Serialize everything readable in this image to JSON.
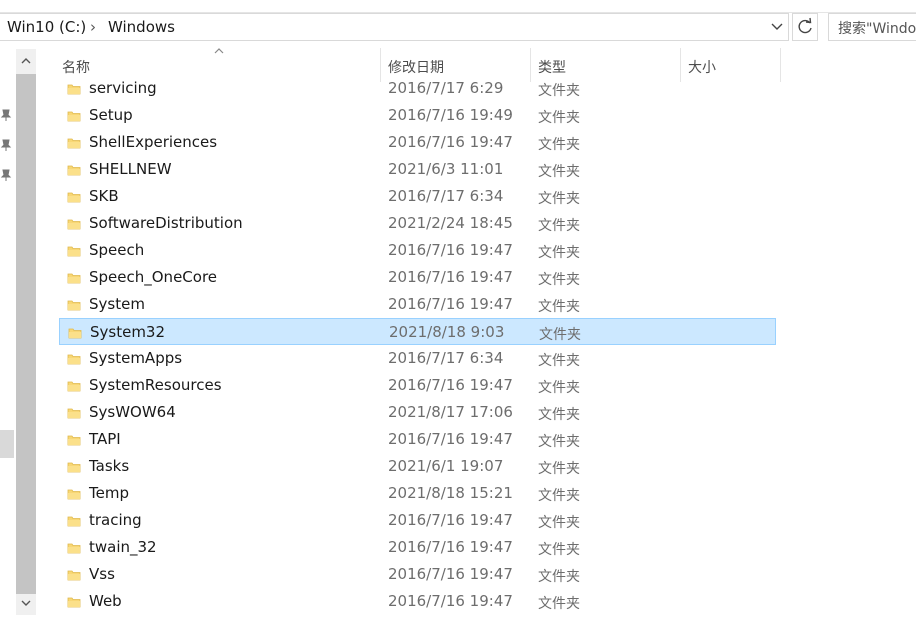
{
  "address": {
    "drive": "Win10 (C:)",
    "separator": "›",
    "folder": "Windows",
    "dropdown_icon": "chevron-down-icon"
  },
  "refresh_icon": "refresh-icon",
  "search": {
    "placeholder": "搜索\"Windows\""
  },
  "columns": {
    "name": "名称",
    "date": "修改日期",
    "type": "类型",
    "size": "大小"
  },
  "colors": {
    "selected_bg": "#cce8ff",
    "selected_border": "#99d1ff",
    "folder": "#f8d775"
  },
  "files": [
    {
      "name": "servicing",
      "date": "2016/7/17 6:29",
      "type": "文件夹",
      "size": "",
      "selected": false
    },
    {
      "name": "Setup",
      "date": "2016/7/16 19:49",
      "type": "文件夹",
      "size": "",
      "selected": false
    },
    {
      "name": "ShellExperiences",
      "date": "2016/7/16 19:47",
      "type": "文件夹",
      "size": "",
      "selected": false
    },
    {
      "name": "SHELLNEW",
      "date": "2021/6/3 11:01",
      "type": "文件夹",
      "size": "",
      "selected": false
    },
    {
      "name": "SKB",
      "date": "2016/7/17 6:34",
      "type": "文件夹",
      "size": "",
      "selected": false
    },
    {
      "name": "SoftwareDistribution",
      "date": "2021/2/24 18:45",
      "type": "文件夹",
      "size": "",
      "selected": false
    },
    {
      "name": "Speech",
      "date": "2016/7/16 19:47",
      "type": "文件夹",
      "size": "",
      "selected": false
    },
    {
      "name": "Speech_OneCore",
      "date": "2016/7/16 19:47",
      "type": "文件夹",
      "size": "",
      "selected": false
    },
    {
      "name": "System",
      "date": "2016/7/16 19:47",
      "type": "文件夹",
      "size": "",
      "selected": false
    },
    {
      "name": "System32",
      "date": "2021/8/18 9:03",
      "type": "文件夹",
      "size": "",
      "selected": true
    },
    {
      "name": "SystemApps",
      "date": "2016/7/17 6:34",
      "type": "文件夹",
      "size": "",
      "selected": false
    },
    {
      "name": "SystemResources",
      "date": "2016/7/16 19:47",
      "type": "文件夹",
      "size": "",
      "selected": false
    },
    {
      "name": "SysWOW64",
      "date": "2021/8/17 17:06",
      "type": "文件夹",
      "size": "",
      "selected": false
    },
    {
      "name": "TAPI",
      "date": "2016/7/16 19:47",
      "type": "文件夹",
      "size": "",
      "selected": false
    },
    {
      "name": "Tasks",
      "date": "2021/6/1 19:07",
      "type": "文件夹",
      "size": "",
      "selected": false
    },
    {
      "name": "Temp",
      "date": "2021/8/18 15:21",
      "type": "文件夹",
      "size": "",
      "selected": false
    },
    {
      "name": "tracing",
      "date": "2016/7/16 19:47",
      "type": "文件夹",
      "size": "",
      "selected": false
    },
    {
      "name": "twain_32",
      "date": "2016/7/16 19:47",
      "type": "文件夹",
      "size": "",
      "selected": false
    },
    {
      "name": "Vss",
      "date": "2016/7/16 19:47",
      "type": "文件夹",
      "size": "",
      "selected": false
    },
    {
      "name": "Web",
      "date": "2016/7/16 19:47",
      "type": "文件夹",
      "size": "",
      "selected": false
    }
  ]
}
